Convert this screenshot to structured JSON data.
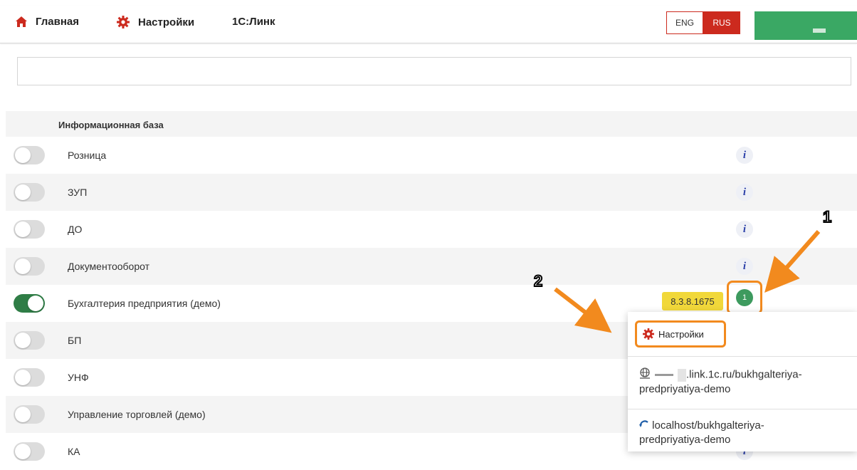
{
  "nav": {
    "home": "Главная",
    "settings": "Настройки",
    "link": "1С:Линк",
    "lang_eng": "ENG",
    "lang_rus": "RUS"
  },
  "table": {
    "header": "Информационная база",
    "rows": [
      {
        "name": "Розница",
        "enabled": false
      },
      {
        "name": "ЗУП",
        "enabled": false
      },
      {
        "name": "ДО",
        "enabled": false
      },
      {
        "name": "Документооборот",
        "enabled": false
      },
      {
        "name": "Бухгалтерия предприятия (демо)",
        "enabled": true,
        "version": "8.3.8.1675",
        "status_count": "1"
      },
      {
        "name": "БП",
        "enabled": false
      },
      {
        "name": "УНФ",
        "enabled": false
      },
      {
        "name": "Управление торговлей (демо)",
        "enabled": false
      },
      {
        "name": "КА",
        "enabled": false
      }
    ]
  },
  "dropdown": {
    "settings": "Настройки",
    "public_url_line1": ".link.1c.ru/bukhgalteriya-",
    "public_url_line2": "predpriyatiya-demo",
    "local_url_line1": "localhost/bukhgalteriya-",
    "local_url_line2": "predpriyatiya-demo"
  },
  "annotations": {
    "one": "1",
    "two": "2"
  },
  "colors": {
    "accent_red": "#cc2a1e",
    "green": "#3aa864",
    "toggle_on": "#2f7d46",
    "highlight_orange": "#f28a1e",
    "version_yellow": "#f1d83a"
  },
  "icons": [
    "home-icon",
    "gear-icon",
    "info-icon",
    "globe-icon",
    "refresh-icon"
  ]
}
